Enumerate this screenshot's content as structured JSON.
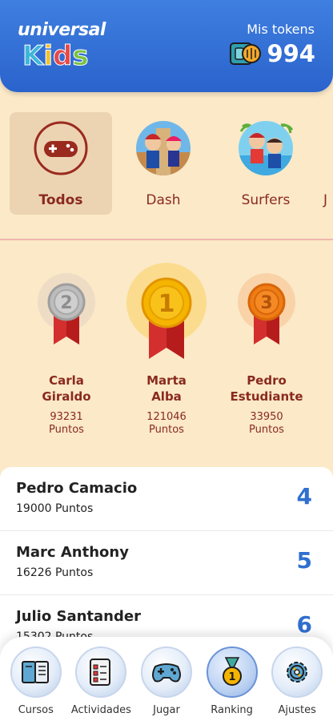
{
  "header": {
    "logo_top": "universal",
    "logo_bottom": [
      "K",
      "i",
      "d",
      "s"
    ],
    "logo_bottom_colors": [
      "#3fb6d9",
      "#f2c12e",
      "#e54b4b",
      "#7bc043"
    ],
    "tokens_label": "Mis tokens",
    "tokens_value": "994",
    "tokens_icon": "token-ticket-coin-icon"
  },
  "categories": [
    {
      "label": "Todos",
      "icon": "gamepad-icon",
      "active": true
    },
    {
      "label": "Dash",
      "icon": "dash-characters-icon",
      "active": false
    },
    {
      "label": "Surfers",
      "icon": "surfers-characters-icon",
      "active": false
    },
    {
      "label": "J",
      "icon": "",
      "active": false
    }
  ],
  "podium": [
    {
      "place": "2",
      "name_line1": "Carla",
      "name_line2": "Giraldo",
      "points": "93231",
      "points_unit": "Puntos"
    },
    {
      "place": "1",
      "name_line1": "Marta",
      "name_line2": "Alba",
      "points": "121046",
      "points_unit": "Puntos"
    },
    {
      "place": "3",
      "name_line1": "Pedro",
      "name_line2": "Estudiante",
      "points": "33950",
      "points_unit": "Puntos"
    }
  ],
  "ranking_list": [
    {
      "name": "Pedro Camacio",
      "points": "19000 Puntos",
      "rank": "4"
    },
    {
      "name": "Marc Anthony",
      "points": "16226 Puntos",
      "rank": "5"
    },
    {
      "name": "Julio Santander",
      "points": "15302 Puntos",
      "rank": "6"
    }
  ],
  "nav": [
    {
      "label": "Cursos",
      "icon": "book-icon",
      "active": false
    },
    {
      "label": "Actividades",
      "icon": "checklist-icon",
      "active": false
    },
    {
      "label": "Jugar",
      "icon": "gamepad-icon",
      "active": false
    },
    {
      "label": "Ranking",
      "icon": "medal-icon",
      "active": true
    },
    {
      "label": "Ajustes",
      "icon": "gear-icon",
      "active": false
    }
  ],
  "colors": {
    "header_blue": "#3f7fe0",
    "background": "#fbe9c8",
    "text_brown": "#8a2a1f",
    "rank_blue": "#2f6fcf",
    "gold": "#f5b400",
    "silver": "#bdbdbd",
    "bronze": "#ef7d15"
  }
}
